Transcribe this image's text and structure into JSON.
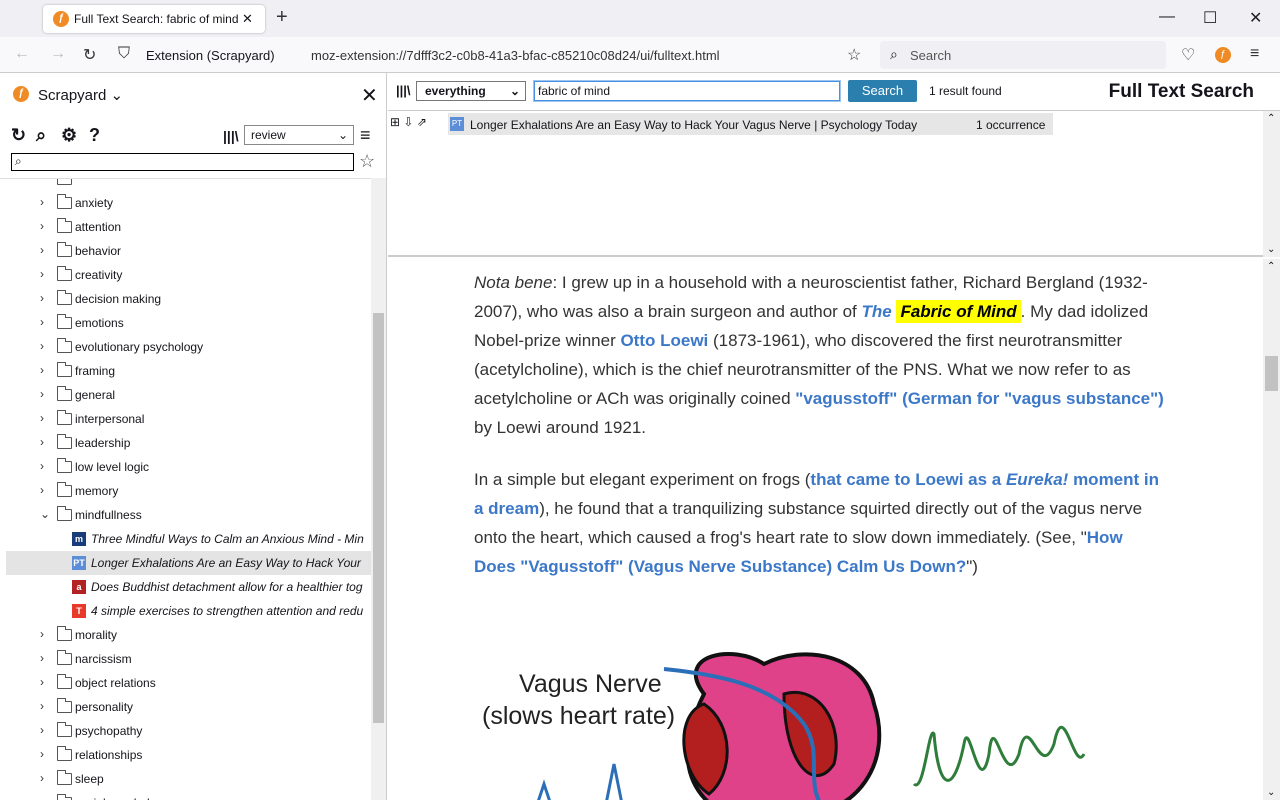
{
  "browser": {
    "tab_title": "Full Text Search: fabric of mind",
    "ext_label": "Extension (Scrapyard)",
    "url": "moz-extension://7dfff3c2-c0b8-41a3-bfac-c85210c08d24/ui/fulltext.html",
    "search_placeholder": "Search"
  },
  "sidebar": {
    "title": "Scrapyard",
    "shelf": "review",
    "items": [
      "anxiety",
      "attention",
      "behavior",
      "creativity",
      "decision making",
      "emotions",
      "evolutionary psychology",
      "framing",
      "general",
      "interpersonal",
      "leadership",
      "low level logic",
      "memory",
      "mindfullness",
      "morality",
      "narcissism",
      "object relations",
      "personality",
      "psychopathy",
      "relationships",
      "sleep",
      "social psychology"
    ],
    "bookmarks": [
      "Three Mindful Ways to Calm an Anxious Mind - Min",
      "Longer Exhalations Are an Easy Way to Hack Your",
      "Does Buddhist detachment allow for a healthier tog",
      "4 simple exercises to strengthen attention and redu"
    ]
  },
  "fulltext": {
    "scope": "everything",
    "query": "fabric of mind",
    "search_label": "Search",
    "found": "1 result found",
    "heading": "Full Text Search",
    "result_title": "Longer Exhalations Are an Easy Way to Hack Your Vagus Nerve | Psychology Today",
    "result_count": "1 occurrence"
  },
  "article": {
    "p1a": "Nota bene",
    "p1b": ": I grew up in a household with a neuroscientist father, Richard Bergland (1932-2007), who was also a brain surgeon and author of ",
    "p1c": "The",
    "p1d": "Fabric of Mind",
    "p1e": ". My dad idolized Nobel-prize winner ",
    "p1f": "Otto Loewi",
    "p1g": " (1873-1961), who discovered the first neurotransmitter (acetylcholine), which is the chief neurotransmitter of the PNS. What we now refer to as acetylcholine or ACh was originally coined ",
    "p1h": "\"vagusstoff\" (German for \"vagus substance\")",
    "p1i": " by Loewi around 1921.",
    "p2a": "In a simple but elegant experiment on frogs (",
    "p2b": "that came to Loewi as a ",
    "p2c": "Eureka!",
    "p2d": " moment in a dream",
    "p2e": "), he found that a tranquilizing substance squirted directly out of the vagus nerve onto the heart, which caused a frog's heart rate to slow down immediately. (See, \"",
    "p2f": "How Does \"Vagusstoff\" (Vagus Nerve Substance) Calm Us Down?",
    "p2g": "\")",
    "fig_label1": "Vagus Nerve",
    "fig_label2": "(slows heart rate)"
  }
}
